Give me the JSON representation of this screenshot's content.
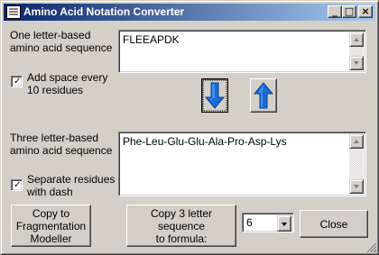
{
  "window": {
    "title": "Amino Acid Notation Converter",
    "controls": {
      "minimize": "_",
      "maximize": "□",
      "close": "×"
    }
  },
  "one_letter": {
    "label": "One letter-based\namino acid sequence",
    "value": "FLEEAPDK"
  },
  "add_space": {
    "checked": true,
    "label": "Add space every\n10 residues"
  },
  "convert": {
    "down_icon": "arrow-down-icon",
    "up_icon": "arrow-up-icon",
    "arrow_color": "#1a6bd6"
  },
  "three_letter": {
    "label": "Three letter-based\namino acid sequence",
    "value": "Phe-Leu-Glu-Glu-Ala-Pro-Asp-Lys"
  },
  "separate_dash": {
    "checked": true,
    "label": "Separate residues\nwith dash"
  },
  "buttons": {
    "copy_fragmentation": "Copy to\nFragmentation\nModeller",
    "copy_formula": "Copy 3 letter sequence\nto formula:",
    "close": "Close"
  },
  "formula_select": {
    "selected": "6"
  }
}
